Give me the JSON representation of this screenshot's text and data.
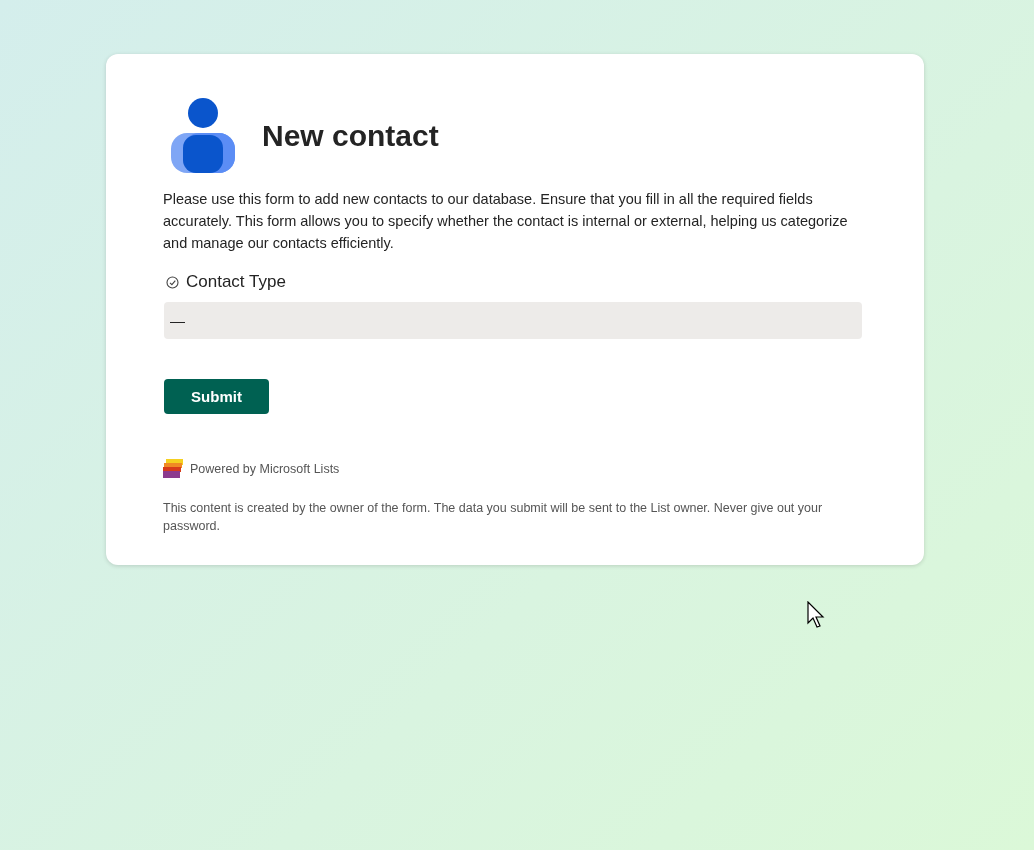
{
  "form": {
    "title": "New contact",
    "description": "Please use this form to add new contacts to our database. Ensure that you fill in all the required fields accurately. This form allows you to specify whether the contact is internal or external, helping us categorize and manage our contacts efficiently.",
    "fields": [
      {
        "kind": "choice",
        "label": "Contact Type",
        "value": "—"
      }
    ],
    "submit": "Submit",
    "powered_by": "Powered by Microsoft Lists",
    "disclaimer": "This content is created by the owner of the form. The data you submit will be sent to the List owner. Never give out your password."
  }
}
